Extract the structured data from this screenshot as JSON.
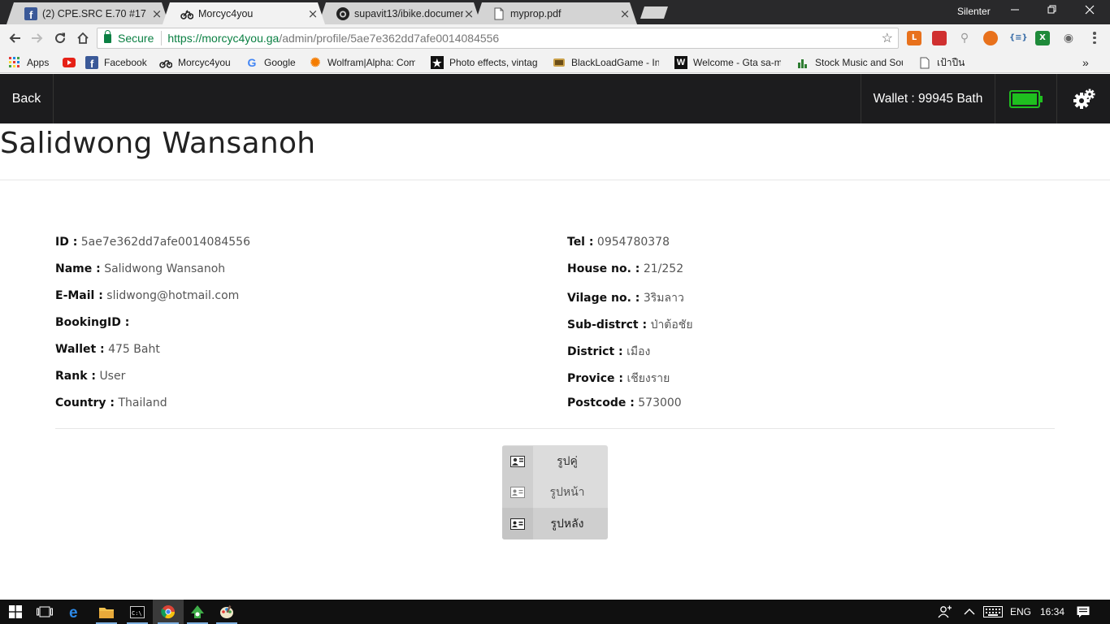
{
  "browser": {
    "tabs": [
      {
        "title": "(2) CPE.SRC E.70 #17",
        "icon": "facebook-icon",
        "active": false
      },
      {
        "title": "Morcyc4you",
        "icon": "motorcycle-icon",
        "active": true
      },
      {
        "title": "supavit13/ibike.documen",
        "icon": "github-icon",
        "active": false
      },
      {
        "title": "myprop.pdf",
        "icon": "document-icon",
        "active": false
      }
    ],
    "profile_name": "Silenter",
    "omnibox": {
      "secure_label": "Secure",
      "url_origin": "https://morcyc4you.ga",
      "url_path": "/admin/profile/5ae7e362dd7afe0014084556"
    },
    "bookmarks": [
      {
        "label": "Apps",
        "icon": "apps-grid-icon"
      },
      {
        "label": "",
        "icon": "youtube-icon"
      },
      {
        "label": "Facebook",
        "icon": "facebook-icon"
      },
      {
        "label": "Morcyc4you",
        "icon": "motorcycle-icon"
      },
      {
        "label": "Google",
        "icon": "google-icon"
      },
      {
        "label": "Wolfram|Alpha: Com",
        "icon": "wolfram-icon"
      },
      {
        "label": "Photo effects, vintag",
        "icon": "star-icon"
      },
      {
        "label": "BlackLoadGame - Inc",
        "icon": "game-icon"
      },
      {
        "label": "Welcome - Gta sa-m",
        "icon": "w-icon"
      },
      {
        "label": "Stock Music and Sou",
        "icon": "music-icon"
      },
      {
        "label": "เป้าปืน",
        "icon": "page-icon"
      }
    ],
    "more_bookmarks": "»"
  },
  "navbar": {
    "back_label": "Back",
    "wallet_text": "Wallet : 99945 Bath",
    "battery_color": "#1fbf1f"
  },
  "profile": {
    "title": "Salidwong Wansanoh",
    "left": [
      {
        "label": "ID :",
        "value": "5ae7e362dd7afe0014084556"
      },
      {
        "label": "Name :",
        "value": "Salidwong Wansanoh"
      },
      {
        "label": "E-Mail :",
        "value": "slidwong@hotmail.com"
      },
      {
        "label": "BookingID :",
        "value": ""
      },
      {
        "label": "Wallet :",
        "value": "475 Baht"
      },
      {
        "label": "Rank :",
        "value": "User"
      },
      {
        "label": "Country :",
        "value": "Thailand"
      }
    ],
    "right": [
      {
        "label": "Tel :",
        "value": "0954780378"
      },
      {
        "label": "House no. :",
        "value": "21/252"
      },
      {
        "label": "Vilage no. :",
        "value": "3ริมลาว"
      },
      {
        "label": "Sub-distrct :",
        "value": "ป่าต้อชัย"
      },
      {
        "label": "District :",
        "value": "เมือง"
      },
      {
        "label": "Provice :",
        "value": "เชียงราย"
      },
      {
        "label": "Postcode :",
        "value": "573000"
      }
    ],
    "photo_menu": [
      {
        "label": "รูปคู่",
        "icon": "portrait-photo-icon",
        "selected": false
      },
      {
        "label": "รูปหน้า",
        "icon": "id-card-front-icon",
        "selected": false
      },
      {
        "label": "รูปหลัง",
        "icon": "id-card-back-icon",
        "selected": true
      }
    ]
  },
  "taskbar": {
    "language": "ENG",
    "time": "16:34"
  }
}
